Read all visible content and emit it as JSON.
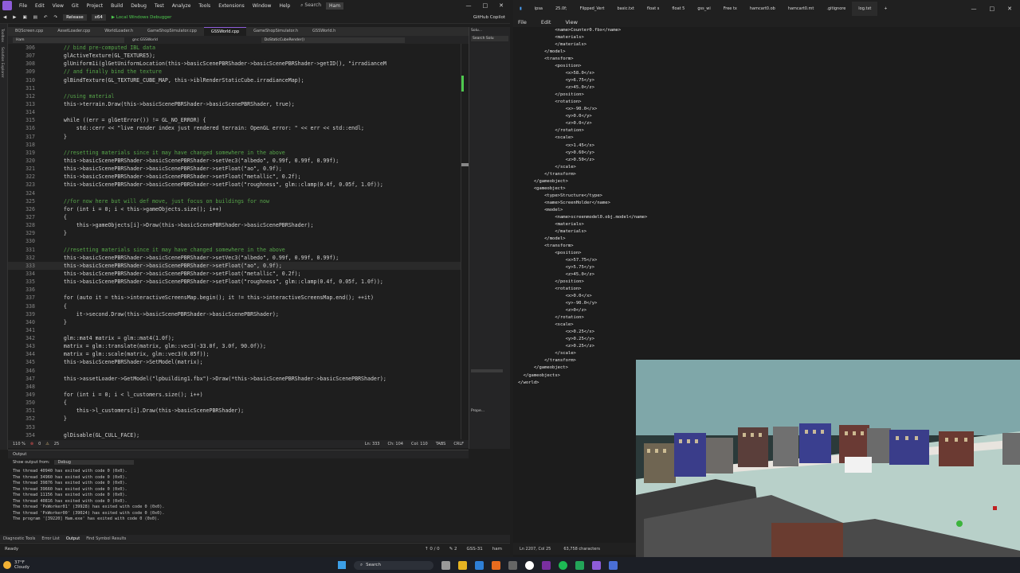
{
  "vs": {
    "menu": [
      "File",
      "Edit",
      "View",
      "Git",
      "Project",
      "Build",
      "Debug",
      "Test",
      "Analyze",
      "Tools",
      "Extensions",
      "Window",
      "Help"
    ],
    "search_label": "Search",
    "solution_name": "Ham",
    "window_controls": [
      "—",
      "□",
      "✕"
    ],
    "toolbar": {
      "config": "Release",
      "platform": "x64",
      "run": "▶ Local Windows Debugger",
      "copilot": "GitHub Copilot"
    },
    "left_strip": [
      "Toolbox",
      "Solution Explorer"
    ],
    "tabs": [
      "BQScreen.cpp",
      "AssetLoader.cpp",
      "WorldLoader.h",
      "GameShopSimulator.cpp",
      "GSSWorld.cpp",
      "GameShopSimulator.h",
      "GSSWorld.h"
    ],
    "active_tab_index": 4,
    "nav": {
      "project": "Ham",
      "scope": "gnc:GSSWorld",
      "member": "DoStaticCubeRender()"
    },
    "code_lines": [
      {
        "n": "306",
        "t": "    // bind pre-computed IBL data"
      },
      {
        "n": "307",
        "t": "    glActiveTexture(GL_TEXTURE5);"
      },
      {
        "n": "308",
        "t": "    glUniform1i(glGetUniformLocation(this->basicScenePBRShader->basicScenePBRShader->getID(), \"irradianceM"
      },
      {
        "n": "309",
        "t": "    // and finally bind the texture"
      },
      {
        "n": "310",
        "t": "    glBindTexture(GL_TEXTURE_CUBE_MAP, this->iblRenderStaticCube.irradianceMap);"
      },
      {
        "n": "311",
        "t": ""
      },
      {
        "n": "312",
        "t": "    //using material"
      },
      {
        "n": "313",
        "t": "    this->terrain.Draw(this->basicScenePBRShader->basicScenePBRShader, true);"
      },
      {
        "n": "314",
        "t": ""
      },
      {
        "n": "315",
        "t": "    while ((err = glGetError()) != GL_NO_ERROR) {"
      },
      {
        "n": "316",
        "t": "        std::cerr << \"live render index just rendered terrain: OpenGL error: \" << err << std::endl;"
      },
      {
        "n": "317",
        "t": "    }"
      },
      {
        "n": "318",
        "t": ""
      },
      {
        "n": "319",
        "t": "    //resetting materials since it may have changed somewhere in the above"
      },
      {
        "n": "320",
        "t": "    this->basicScenePBRShader->basicScenePBRShader->setVec3(\"albedo\", 0.99f, 0.99f, 0.99f);"
      },
      {
        "n": "321",
        "t": "    this->basicScenePBRShader->basicScenePBRShader->setFloat(\"ao\", 0.9f);"
      },
      {
        "n": "322",
        "t": "    this->basicScenePBRShader->basicScenePBRShader->setFloat(\"metallic\", 0.2f);"
      },
      {
        "n": "323",
        "t": "    this->basicScenePBRShader->basicScenePBRShader->setFloat(\"roughness\", glm::clamp(0.4f, 0.05f, 1.0f));"
      },
      {
        "n": "324",
        "t": ""
      },
      {
        "n": "325",
        "t": "    //for now here but will def move, just focus on buildings for now"
      },
      {
        "n": "326",
        "t": "    for (int i = 0; i < this->gameObjects.size(); i++)"
      },
      {
        "n": "327",
        "t": "    {"
      },
      {
        "n": "328",
        "t": "        this->gameObjects[i]->Draw(this->basicScenePBRShader->basicScenePBRShader);"
      },
      {
        "n": "329",
        "t": "    }"
      },
      {
        "n": "330",
        "t": ""
      },
      {
        "n": "331",
        "t": "    //resetting materials since it may have changed somewhere in the above"
      },
      {
        "n": "332",
        "t": "    this->basicScenePBRShader->basicScenePBRShader->setVec3(\"albedo\", 0.99f, 0.99f, 0.99f);"
      },
      {
        "n": "333",
        "t": "    this->basicScenePBRShader->basicScenePBRShader->setFloat(\"ao\", 0.9f);"
      },
      {
        "n": "334",
        "t": "    this->basicScenePBRShader->basicScenePBRShader->setFloat(\"metallic\", 0.2f);"
      },
      {
        "n": "335",
        "t": "    this->basicScenePBRShader->basicScenePBRShader->setFloat(\"roughness\", glm::clamp(0.4f, 0.05f, 1.0f));"
      },
      {
        "n": "336",
        "t": ""
      },
      {
        "n": "337",
        "t": "    for (auto it = this->interactiveScreensMap.begin(); it != this->interactiveScreensMap.end(); ++it)"
      },
      {
        "n": "338",
        "t": "    {"
      },
      {
        "n": "339",
        "t": "        it->second.Draw(this->basicScenePBRShader->basicScenePBRShader);"
      },
      {
        "n": "340",
        "t": "    }"
      },
      {
        "n": "341",
        "t": ""
      },
      {
        "n": "342",
        "t": "    glm::mat4 matrix = glm::mat4(1.0f);"
      },
      {
        "n": "343",
        "t": "    matrix = glm::translate(matrix, glm::vec3(-33.0f, 3.0f, 90.0f));"
      },
      {
        "n": "344",
        "t": "    matrix = glm::scale(matrix, glm::vec3(0.05f));"
      },
      {
        "n": "345",
        "t": "    this->basicScenePBRShader->SetModel(matrix);"
      },
      {
        "n": "346",
        "t": ""
      },
      {
        "n": "347",
        "t": "    this->assetLoader->GetModel(\"lpbuilding1.fbx\")->Draw(*this->basicScenePBRShader->basicScenePBRShader);"
      },
      {
        "n": "348",
        "t": ""
      },
      {
        "n": "349",
        "t": "    for (int i = 0; i < l_customers.size(); i++)"
      },
      {
        "n": "350",
        "t": "    {"
      },
      {
        "n": "351",
        "t": "        this->l_customers[i].Draw(this->basicScenePBRShader);"
      },
      {
        "n": "352",
        "t": "    }"
      },
      {
        "n": "353",
        "t": ""
      },
      {
        "n": "354",
        "t": "    glDisable(GL_CULL_FACE);"
      }
    ],
    "current_line": "333",
    "edit_status": {
      "zoom": "110 %",
      "errors": "0",
      "warnings": "25",
      "ln": "Ln: 333",
      "ch": "Ch: 104",
      "col": "Col: 110",
      "enc": "TABS",
      "eol": "CRLF"
    },
    "solution_panel": {
      "header": "Solu...",
      "search": "Search Solu",
      "properties": "Prope..."
    },
    "output": {
      "title": "Output",
      "show_from_label": "Show output from:",
      "show_from_value": "Debug",
      "lines": [
        "The thread 40940 has exited with code 0 (0x0).",
        "The thread 34960 has exited with code 0 (0x0).",
        "The thread 39876 has exited with code 0 (0x0).",
        "The thread 39660 has exited with code 0 (0x0).",
        "The thread 11156 has exited with code 0 (0x0).",
        "The thread 40816 has exited with code 0 (0x0).",
        "The thread 'PxWorker01' (39928) has exited with code 0 (0x0).",
        "The thread 'PxWorker00' (39024) has exited with code 0 (0x0).",
        "The program '[39220] Ham.exe' has exited with code 0 (0x0)."
      ]
    },
    "bottom_tabs": [
      "Diagnostic Tools",
      "Error List",
      "Output",
      "Find Symbol Results"
    ],
    "status": {
      "ready": "Ready",
      "up": "↑ 0 / 0",
      "pencil": "✎ 2",
      "branch": "GSS-31",
      "repo": "ham"
    }
  },
  "notepad": {
    "tabs": [
      "ipsa",
      "25.0f;",
      "Flipped_Vert",
      "basic.txt",
      "float s",
      "float 5",
      "gss_wi",
      "Free tx",
      "hamcart0.ob",
      "hamcart0.mt",
      ".gitignore",
      "log.txt"
    ],
    "active_tab_index": 11,
    "menu": [
      "File",
      "Edit",
      "View"
    ],
    "xml_lines": [
      "              <name>Counter0.fbx</name>",
      "              <materials>",
      "              </materials>",
      "          </model>",
      "          <transform>",
      "              <position>",
      "                  <x>58.0</x>",
      "                  <y>6.75</y>",
      "                  <z>45.0</z>",
      "              </position>",
      "              <rotation>",
      "                  <x>-90.0</x>",
      "                  <y>0.0</y>",
      "                  <z>0.0</z>",
      "              </rotation>",
      "              <scale>",
      "                  <x>1.45</x>",
      "                  <y>0.60</y>",
      "                  <z>0.50</z>",
      "              </scale>",
      "          </transform>",
      "      </gameobject>",
      "      <gameobject>",
      "          <type>Structure</type>",
      "          <name>ScreenHolder</name>",
      "          <model>",
      "              <name>screenmodel0.obj.model</name>",
      "              <materials>",
      "              </materials>",
      "          </model>",
      "          <transform>",
      "              <position>",
      "                  <x>57.75</x>",
      "                  <y>5.75</y>",
      "                  <z>45.0</z>",
      "              </position>",
      "              <rotation>",
      "                  <x>0.0</x>",
      "                  <y>-90.0</y>",
      "                  <z>0</z>",
      "              </rotation>",
      "              <scale>",
      "                  <x>0.25</x>",
      "                  <y>0.25</y>",
      "                  <z>0.25</z>",
      "              </scale>",
      "          </transform>",
      "      </gameobject>",
      "  </gameobjects>",
      "</world>"
    ],
    "status": {
      "pos": "Ln 2207, Col 25",
      "chars": "63,758 characters"
    }
  },
  "taskbar": {
    "temp": "37°F",
    "condition": "Cloudy",
    "search": "Search"
  }
}
